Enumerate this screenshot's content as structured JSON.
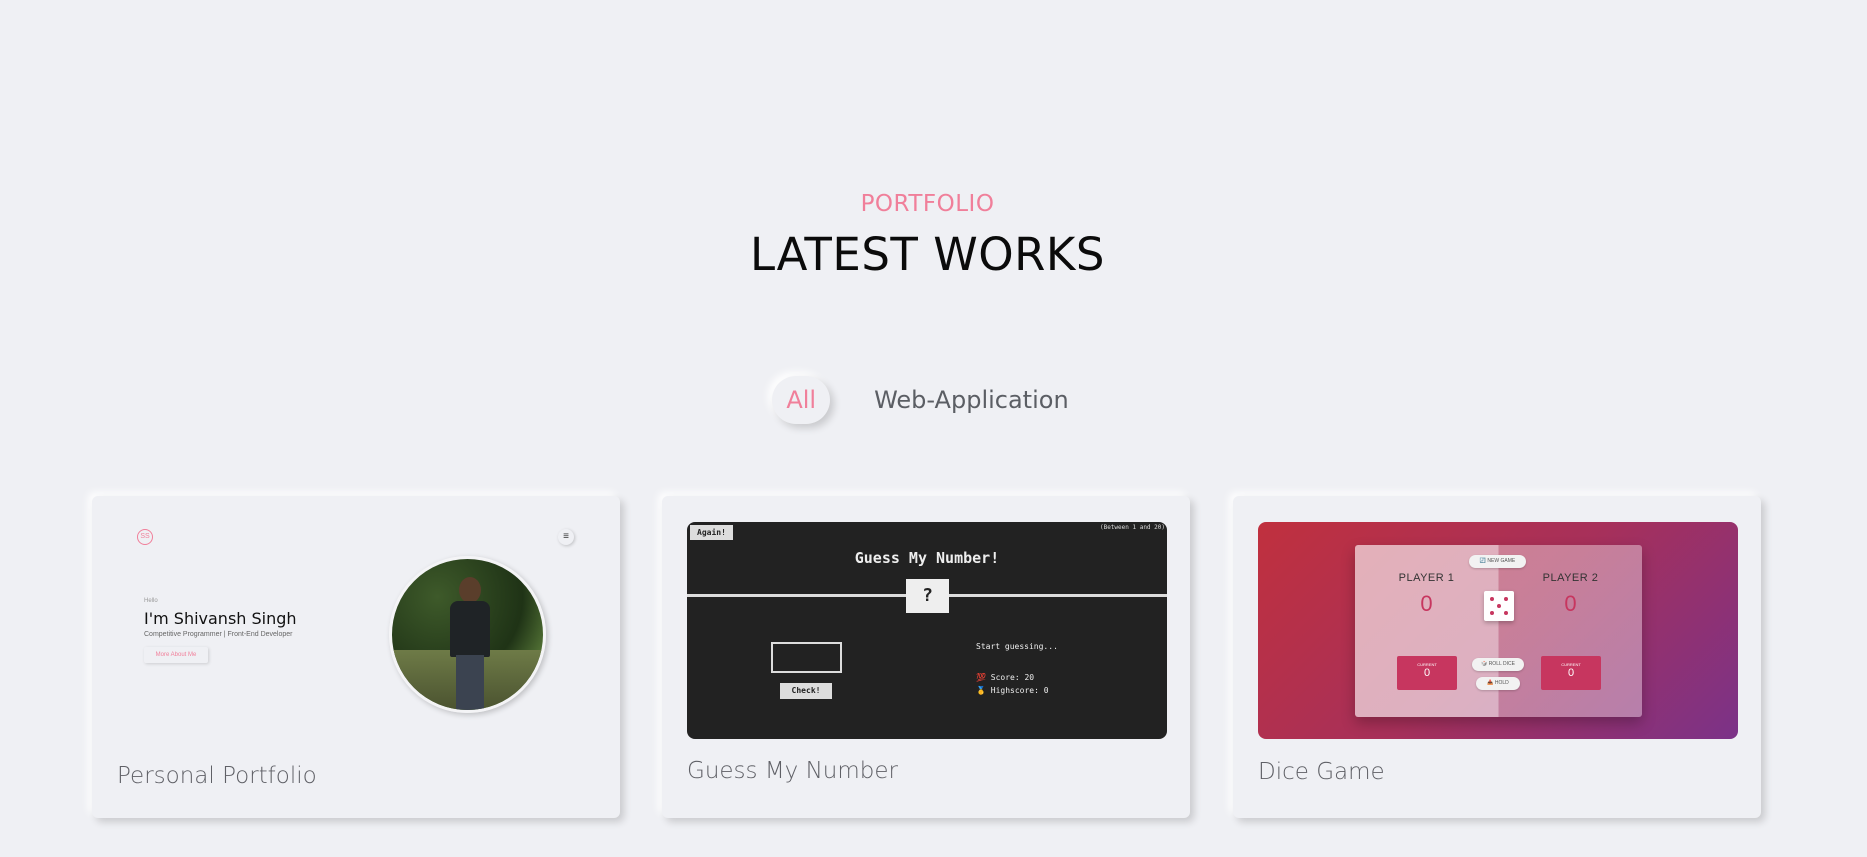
{
  "header": {
    "section_tag": "PORTFOLIO",
    "section_title": "LATEST WORKS"
  },
  "filters": [
    {
      "label": "All",
      "active": true
    },
    {
      "label": "Web-Application",
      "active": false
    }
  ],
  "colors": {
    "accent": "#f07f9a",
    "background": "#eff0f4",
    "title": "#0b0b0b"
  },
  "cards": [
    {
      "title": "Personal Portfolio",
      "preview": {
        "logo": "SS",
        "greeting": "Hello",
        "name": "I'm Shivansh Singh",
        "role": "Competitive Programmer | Front-End Developer",
        "button": "More About Me",
        "menu_icon": "menu-icon"
      }
    },
    {
      "title": "Guess My Number",
      "preview": {
        "again": "Again!",
        "range": "(Between 1 and 20)",
        "heading": "Guess My Number!",
        "secret": "?",
        "check": "Check!",
        "message": "Start guessing...",
        "score": "💯 Score: 20",
        "highscore": "🥇 Highscore: 0"
      }
    },
    {
      "title": "Dice Game",
      "preview": {
        "new_game": "🔄 NEW GAME",
        "player1": "PLAYER 1",
        "player2": "PLAYER 2",
        "score1": "0",
        "score2": "0",
        "current_label": "CURRENT",
        "current1": "0",
        "current2": "0",
        "roll": "🎲 ROLL DICE",
        "hold": "📥 HOLD"
      }
    }
  ]
}
